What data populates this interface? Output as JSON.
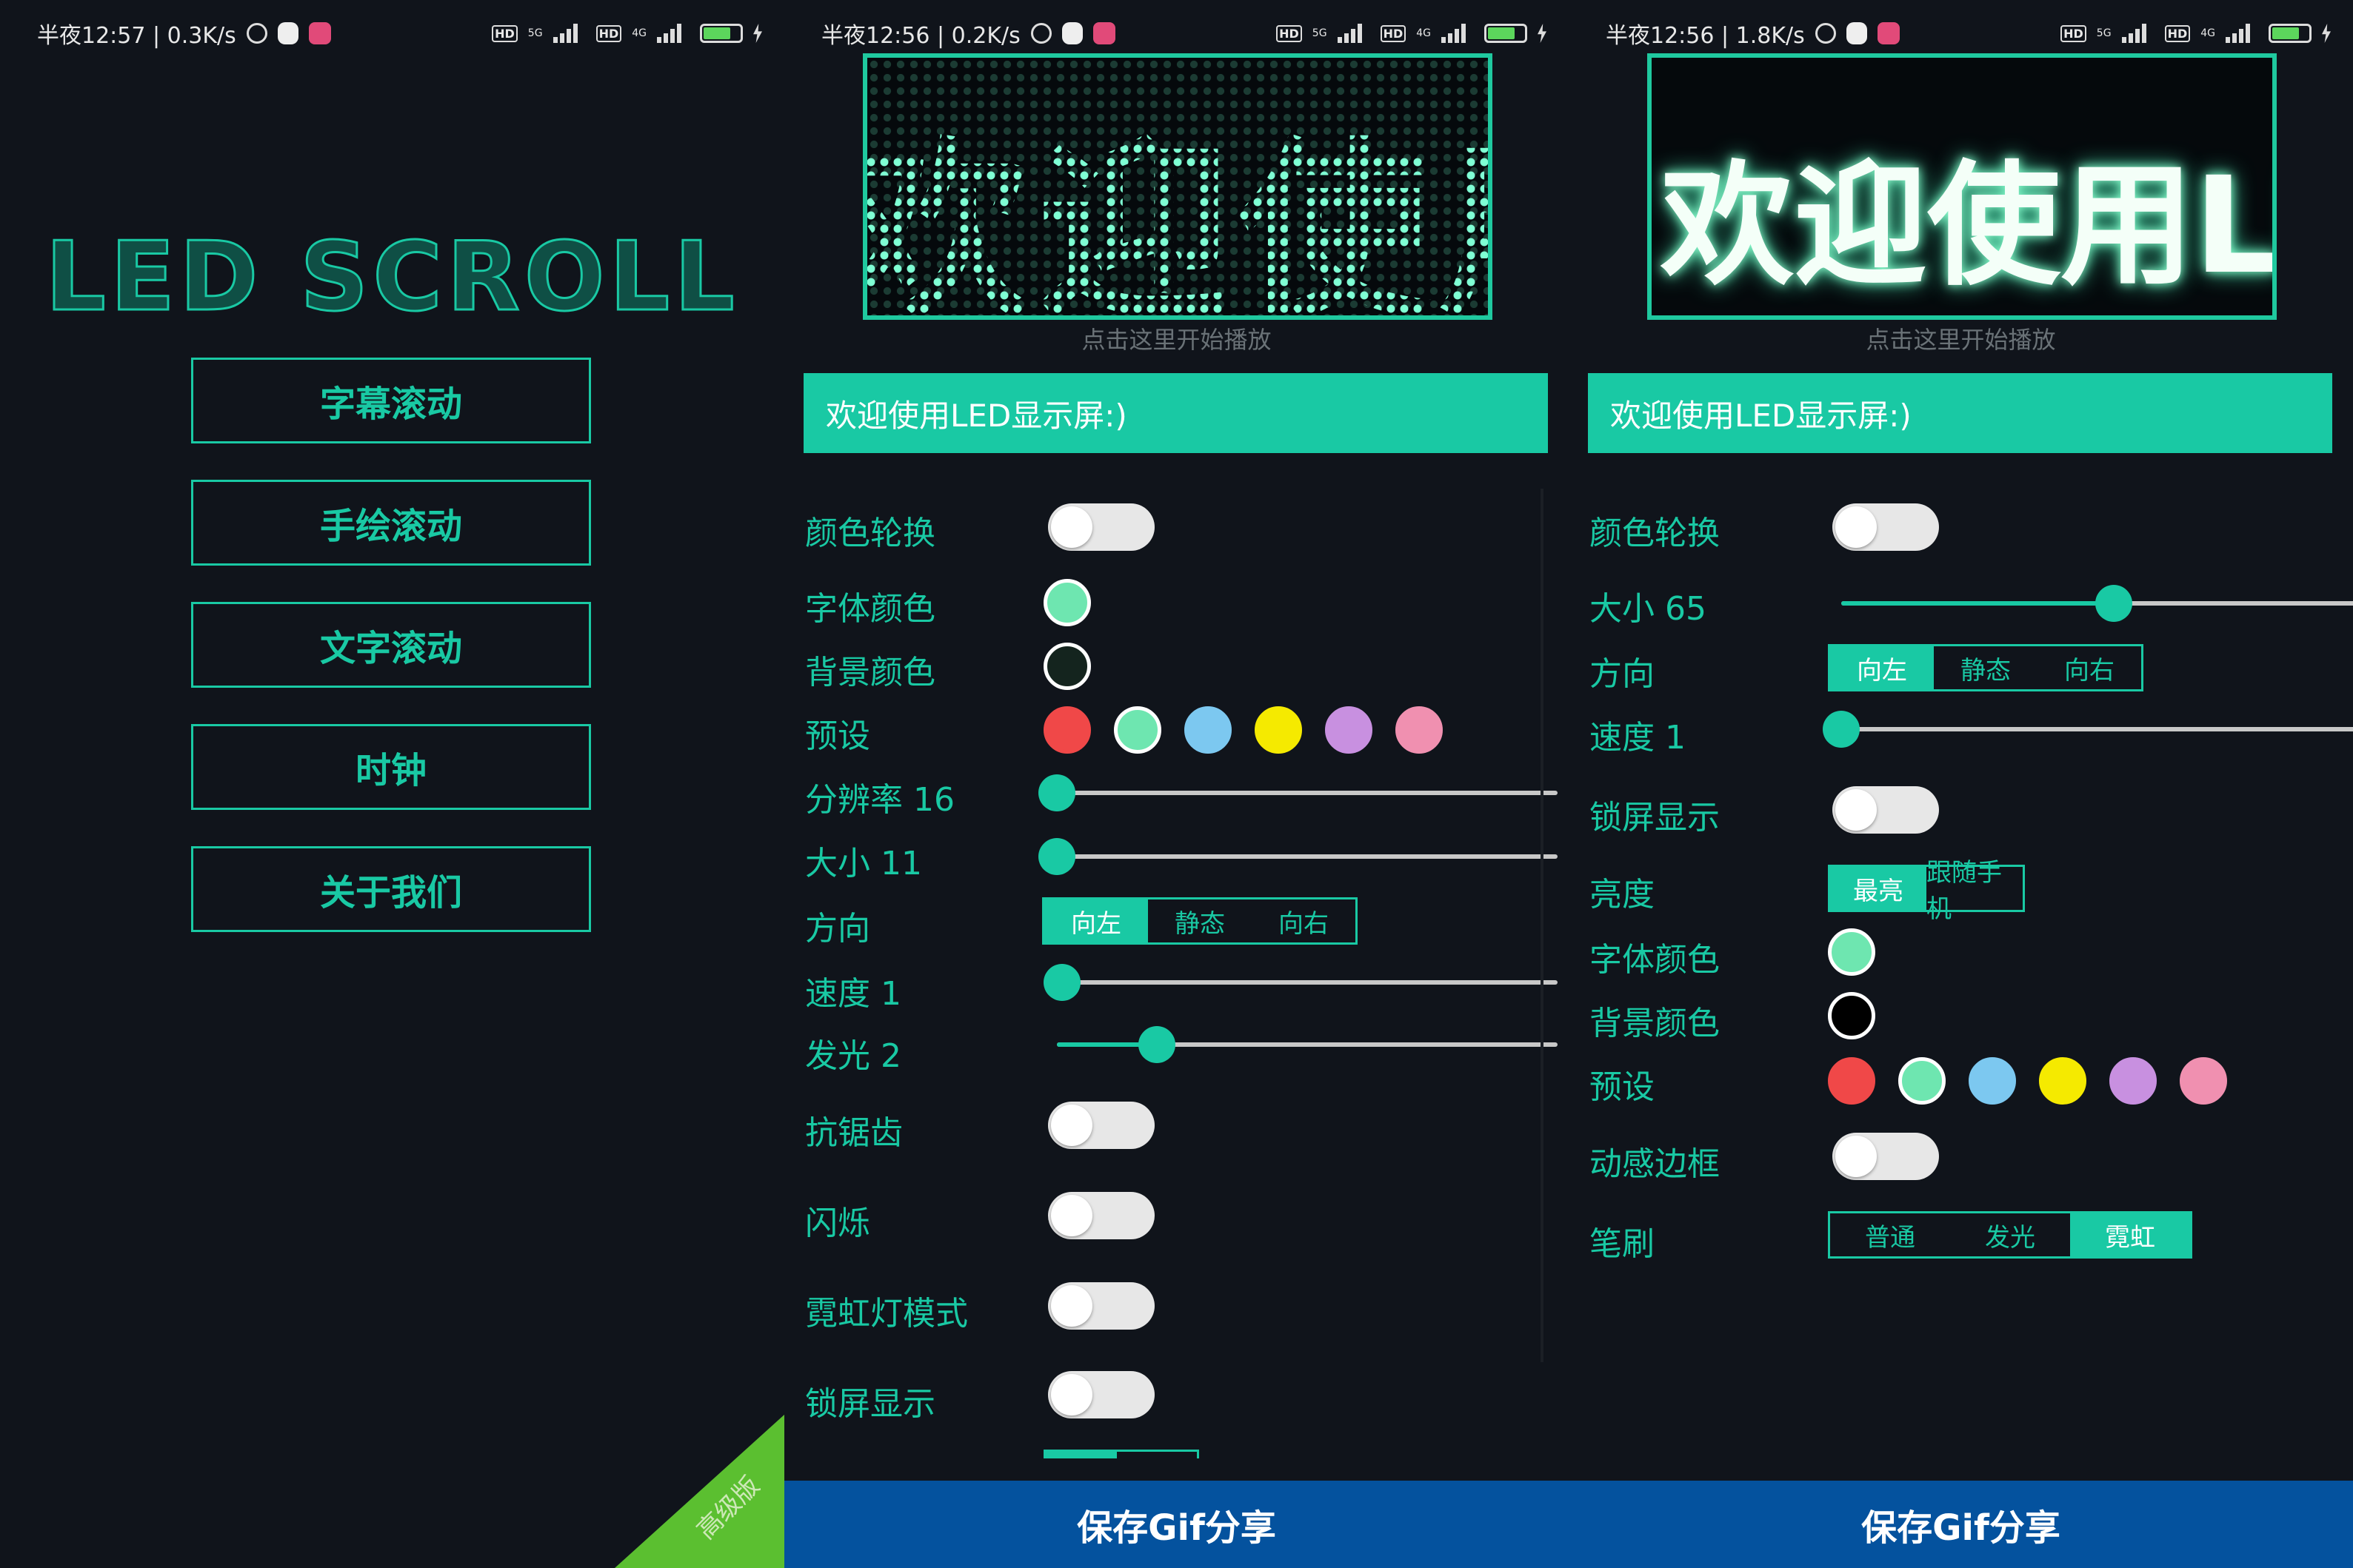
{
  "status_bars": [
    {
      "time": "半夜12:57 | 0.3K/s",
      "net1": "5G",
      "net2": "4G",
      "battery": "73"
    },
    {
      "time": "半夜12:56 | 0.2K/s",
      "net1": "5G",
      "net2": "4G",
      "battery": "73"
    },
    {
      "time": "半夜12:56 | 1.8K/s",
      "net1": "5G",
      "net2": "4G",
      "battery": "73"
    }
  ],
  "home": {
    "logo": "LED SCROLL",
    "menu": [
      "字幕滚动",
      "手绘滚动",
      "文字滚动",
      "时钟",
      "关于我们"
    ],
    "ribbon": "高级版"
  },
  "scroll_settings": {
    "display_text": "欢迎使用",
    "hint": "点击这里开始播放",
    "input_text": "欢迎使用LED显示屏:)",
    "labels": {
      "color_cycle": "颜色轮换",
      "font_color": "字体颜色",
      "bg_color": "背景颜色",
      "preset": "预设",
      "resolution": "分辨率 16",
      "size": "大小 11",
      "direction": "方向",
      "speed": "速度 1",
      "glow": "发光 2",
      "antialias": "抗锯齿",
      "blink": "闪烁",
      "neon": "霓虹灯模式",
      "lock_screen": "锁屏显示"
    },
    "direction_options": [
      "向左",
      "静态",
      "向右"
    ],
    "direction_selected": "向左",
    "slider_levels": {
      "resolution": 0.0,
      "size": 0.0,
      "speed": 0.01,
      "glow": 0.2
    },
    "font_color": "#6ee6b0",
    "bg_color": "#14241e",
    "presets": [
      "#f04848",
      "#6ee6b0",
      "#7cc8f0",
      "#f5ea00",
      "#c890e0",
      "#f090b0"
    ],
    "save": "保存Gif分享"
  },
  "text_settings": {
    "display_text": "欢迎使用LE",
    "hint": "点击这里开始播放",
    "input_text": "欢迎使用LED显示屏:)",
    "labels": {
      "color_cycle": "颜色轮换",
      "size": "大小 65",
      "direction": "方向",
      "speed": "速度 1",
      "lock_screen": "锁屏显示",
      "brightness": "亮度",
      "font_color": "字体颜色",
      "bg_color": "背景颜色",
      "preset": "预设",
      "dynamic_border": "动感边框",
      "brush": "笔刷"
    },
    "direction_options": [
      "向左",
      "静态",
      "向右"
    ],
    "direction_selected": "向左",
    "brightness_options": [
      "最亮",
      "跟随手机"
    ],
    "brightness_selected": "最亮",
    "brush_options": [
      "普通",
      "发光",
      "霓虹"
    ],
    "brush_selected": "霓虹",
    "slider_levels": {
      "size": 0.5,
      "speed": 0.0
    },
    "font_color": "#6ee6b0",
    "bg_color": "#000000",
    "presets": [
      "#f04848",
      "#6ee6b0",
      "#7cc8f0",
      "#f5ea00",
      "#c890e0",
      "#f090b0"
    ],
    "save": "保存Gif分享"
  },
  "colors": {
    "accent": "#19c9a4",
    "save_bar": "#04529e",
    "background": "#10141b"
  }
}
